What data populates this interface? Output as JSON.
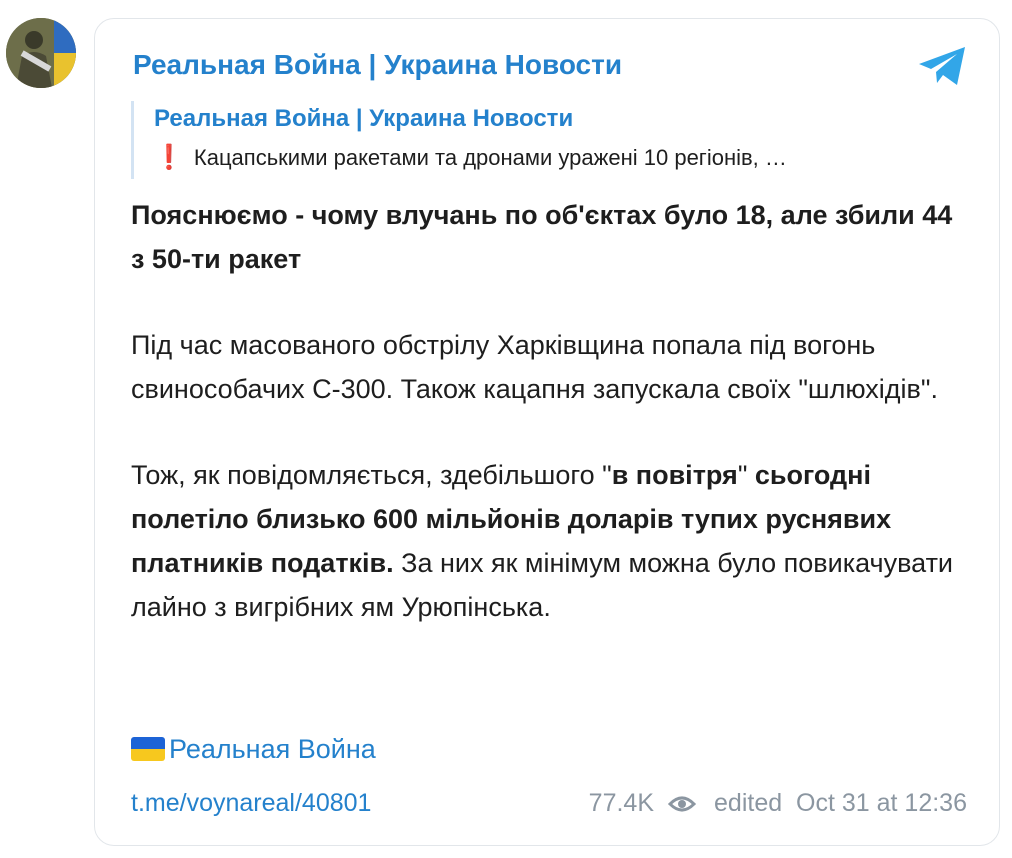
{
  "post": {
    "channel_name": "Реальная Война | Украина Новости",
    "reply": {
      "title": "Реальная Война | Украина Новости",
      "mark": "❗",
      "text": "Кацапськими ракетами та дронами уражені 10 регіонів, …"
    },
    "headline": "Пояснюємо - чому влучань по об'єктах було 18, але збили 44 з 50-ти ракет",
    "para2": "Під час масованого обстрілу Харківщина попала під вогонь свинособачих С-300. Також кацапня запускала своїх \"шлюхідів\".",
    "para3_prefix": "Тож, як повідомляється, здебільшого \"",
    "para3_bold1": "в повітря",
    "para3_mid": "\" ",
    "para3_bold2": "сьогодні полетіло близько 600 мільйонів доларів тупих руснявих платників податків.",
    "para3_suffix": " За них як мінімум можна було повикачувати лайно з вигрібних ям Урюпінська.",
    "signature": "Реальная Война",
    "link": "t.me/voynareal/40801",
    "views": "77.4K",
    "edited": "edited",
    "date": "Oct 31 at 12:36"
  },
  "colors": {
    "link": "#2481cc",
    "meta": "#8b96a1",
    "flag_blue": "#1c63d6",
    "flag_yellow": "#f7c81e"
  },
  "icons": {
    "telegram": "telegram-plane-icon",
    "views": "eye-icon",
    "flag": "ukraine-flag-icon"
  }
}
